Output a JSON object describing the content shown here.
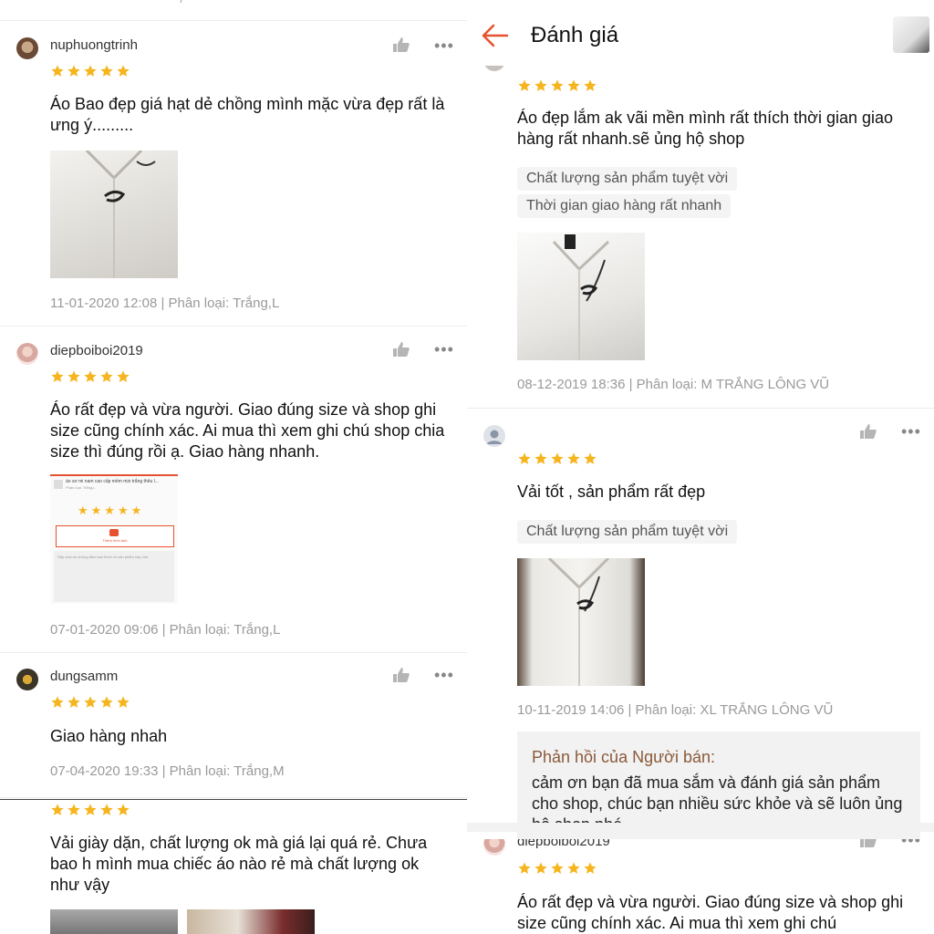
{
  "colors": {
    "star": "#f6b51e",
    "accent": "#e8512f",
    "meta": "#9a9a9a"
  },
  "left": {
    "top_fragment": "— — —   /   —",
    "reviews": [
      {
        "username": "nuphuongtrinh",
        "rating": 5,
        "text": " Áo Bao đẹp giá hạt dẻ chồng mình mặc vừa đẹp rất là ưng ý.........",
        "meta": "11-01-2020 12:08 | Phân loại: Trắng,L"
      },
      {
        "username": "diepboiboi2019",
        "rating": 5,
        "text": "Áo rất đẹp và vừa người. Giao đúng size và shop ghi size cũng chính xác. Ai mua thì xem ghi chú shop chia size thì đúng rồi ạ. Giao hàng nhanh.",
        "meta": "07-01-2020 09:06 | Phân loại: Trắng,L",
        "screenshot": {
          "line1": "áo sơ mi nam cao cấp mềm mịn trắng thêu l...",
          "line2": "Phân loại: Trắng,L",
          "photo_label": "Thêm hình ảnh",
          "placeholder": "Hãy chia sẻ những điều bạn thích về sản phẩm này nhé."
        }
      },
      {
        "username": "dungsamm",
        "rating": 5,
        "text": "Giao hàng nhah",
        "meta": "07-04-2020 19:33 | Phân loại: Trắng,M"
      },
      {
        "rating": 5,
        "text": "Vải giày dặn, chất lượng ok mà giá lại quá rẻ. Chưa bao h mình mua chiếc áo nào rẻ mà chất lượng ok như vậy"
      }
    ]
  },
  "right": {
    "header": {
      "title": "Đánh giá"
    },
    "reviews": [
      {
        "rating": 5,
        "text": "Áo đẹp lắm ak vãi mền mình rất thích thời gian giao hàng rất nhanh.sẽ ủng hộ shop",
        "tags": [
          "Chất lượng sản phẩm tuyệt vời",
          "Thời gian giao hàng rất nhanh"
        ],
        "meta": "08-12-2019 18:36 | Phân loại: M TRẮNG LÔNG VŨ"
      },
      {
        "rating": 5,
        "text": "Vải tốt , sản phẩm rất đẹp",
        "tags": [
          "Chất lượng sản phẩm tuyệt vời"
        ],
        "meta": "10-11-2019 14:06 | Phân loại: XL TRẮNG LÔNG VŨ",
        "seller_reply": {
          "title": "Phản hồi của Người bán:",
          "text": "cảm ơn bạn đã mua sắm và đánh giá sản phẩm cho shop, chúc bạn nhiều sức khỏe và sẽ luôn ủng hộ shop nhé"
        }
      },
      {
        "username": "diepboiboi2019",
        "rating": 5,
        "text": "Áo rất đẹp và vừa người. Giao đúng size và shop ghi size cũng chính xác. Ai mua thì xem ghi chú"
      }
    ]
  }
}
